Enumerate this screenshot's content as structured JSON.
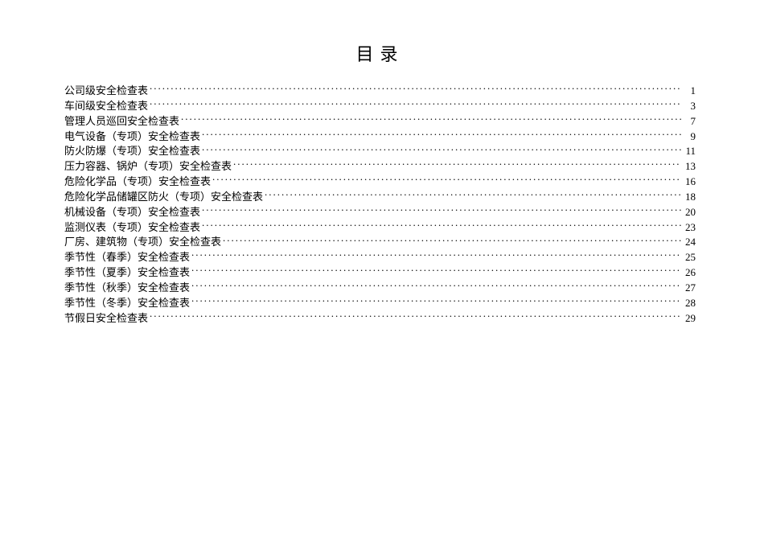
{
  "title": "目录",
  "toc": [
    {
      "label": "公司级安全检查表",
      "page": "1"
    },
    {
      "label": "车间级安全检查表",
      "page": "3"
    },
    {
      "label": "管理人员巡回安全检查表",
      "page": "7"
    },
    {
      "label": "电气设备（专项）安全检查表",
      "page": "9"
    },
    {
      "label": "防火防爆（专项）安全检查表",
      "page": "11"
    },
    {
      "label": "压力容器、锅炉（专项）安全检查表",
      "page": "13"
    },
    {
      "label": "危险化学品（专项）安全检查表",
      "page": "16"
    },
    {
      "label": "危险化学品储罐区防火（专项）安全检查表",
      "page": "18"
    },
    {
      "label": "机械设备（专项）安全检查表",
      "page": "20"
    },
    {
      "label": "监测仪表（专项）安全检查表",
      "page": "23"
    },
    {
      "label": "厂房、建筑物（专项）安全检查表",
      "page": "24"
    },
    {
      "label": "季节性（春季）安全检查表",
      "page": "25"
    },
    {
      "label": "季节性（夏季）安全检查表",
      "page": "26"
    },
    {
      "label": "季节性（秋季）安全检查表",
      "page": "27"
    },
    {
      "label": "季节性（冬季）安全检查表",
      "page": "28"
    },
    {
      "label": "节假日安全检查表",
      "page": "29"
    }
  ]
}
